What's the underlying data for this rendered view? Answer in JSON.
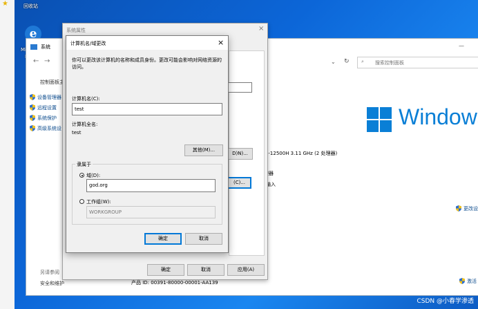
{
  "desktop": {
    "recycle_bin_label": "回收站",
    "edge_label_1": "Mi",
    "edge_label_2": "E"
  },
  "system_window": {
    "title": "系统",
    "search_placeholder": "搜索控制面板",
    "sidebar_title": "控制面板主",
    "sidebar_items": [
      "设备管理器",
      "远程设置",
      "系统保护",
      "高级系统设"
    ],
    "see_also": "另请参阅",
    "security_link": "安全和维护",
    "cpu_info": "i5-12500H   3.11 GHz  (2 处理器)",
    "processor_text": "理器",
    "input_text": "输入",
    "change_settings": "更改设",
    "activate": "激活",
    "product_id": "产品 ID: 00391-80000-00001-AA139",
    "windows_brand": "Windows"
  },
  "system_properties": {
    "title": "系统属性",
    "ok": "确定",
    "cancel": "取消",
    "apply": "应用(A)",
    "btn_d": "D)N)...",
    "btn_c": "(C)..."
  },
  "computer_name_dialog": {
    "title": "计算机名/域更改",
    "description": "你可以更改该计算机的名称和成员身份。更改可能会影响对网络资源的访问。",
    "computer_name_label": "计算机名(C):",
    "computer_name_value": "test",
    "full_name_label": "计算机全名:",
    "full_name_value": "test",
    "more_button": "其他(M)...",
    "member_of_label": "隶属于",
    "domain_label": "域(D):",
    "domain_value": "god.org",
    "workgroup_label": "工作组(W):",
    "workgroup_value": "WORKGROUP",
    "ok": "确定",
    "cancel": "取消",
    "close": "×"
  },
  "watermark": "CSDN @小春学渗透",
  "colors": {
    "accent": "#0078d7",
    "windows_blue": "#0a7fd6",
    "desktop_blue": "#0c66d8"
  }
}
